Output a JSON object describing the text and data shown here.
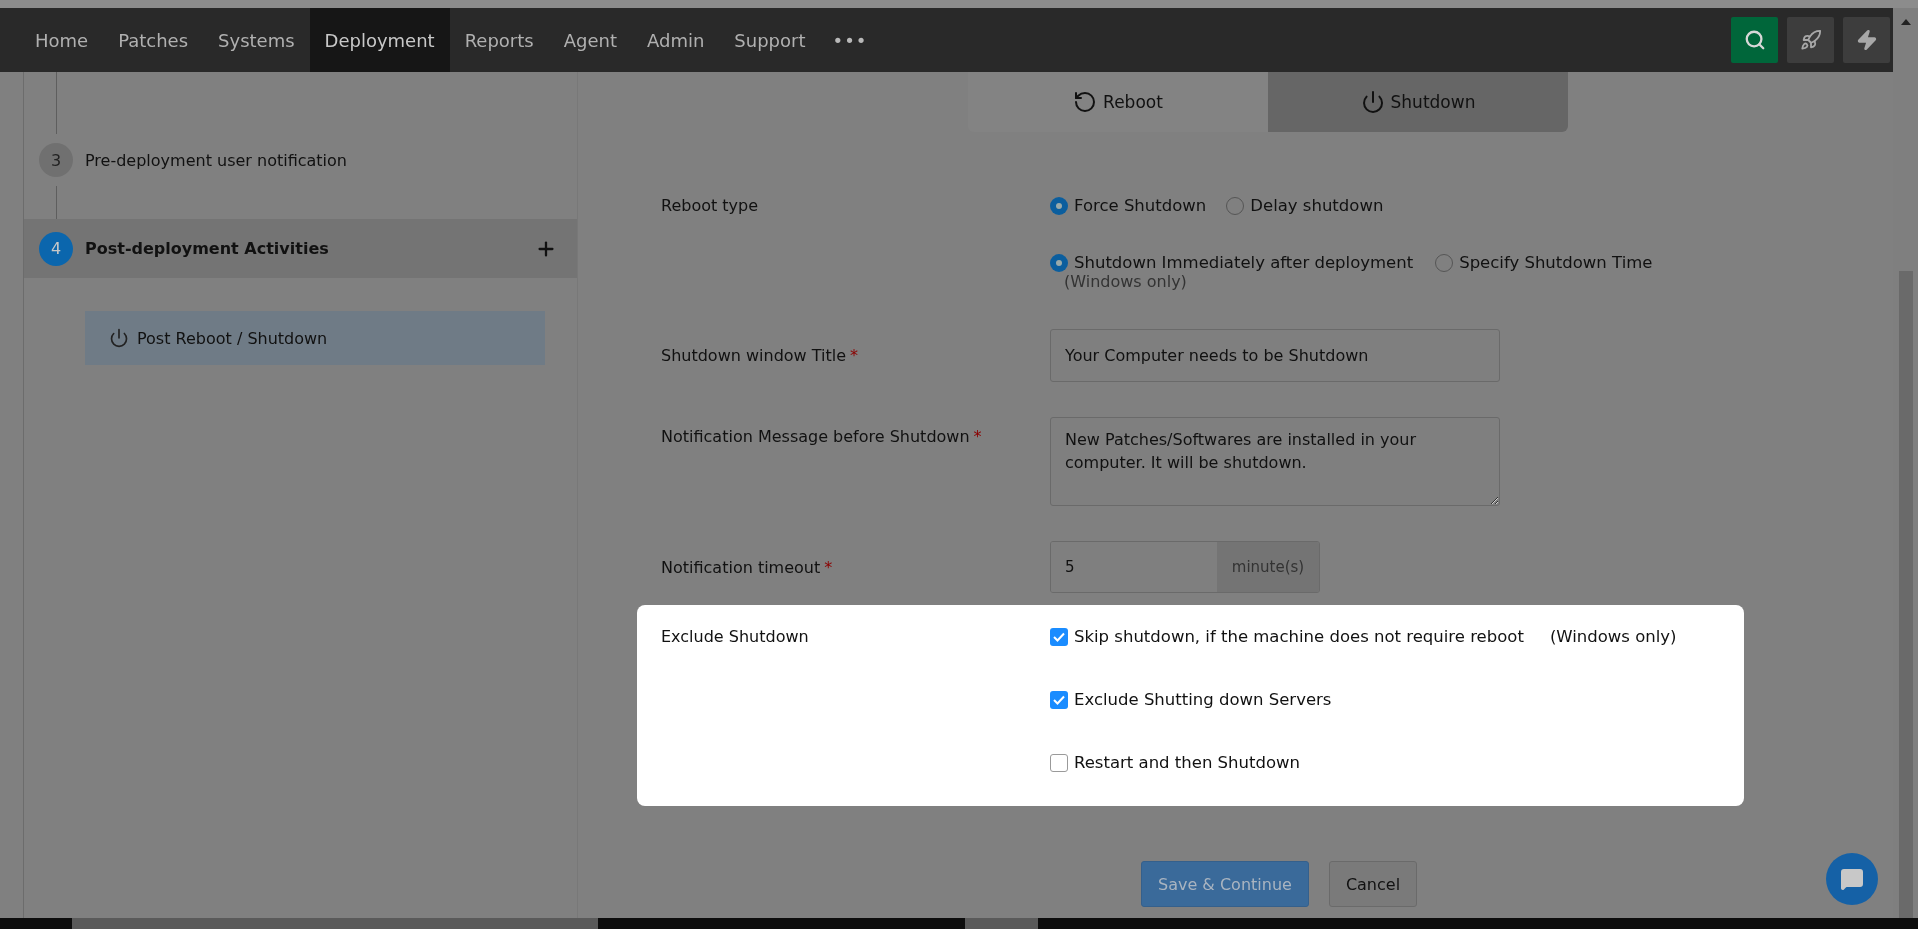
{
  "nav": {
    "items": [
      {
        "label": "Home",
        "selected": false
      },
      {
        "label": "Patches",
        "selected": false
      },
      {
        "label": "Systems",
        "selected": false
      },
      {
        "label": "Deployment",
        "selected": true
      },
      {
        "label": "Reports",
        "selected": false
      },
      {
        "label": "Agent",
        "selected": false
      },
      {
        "label": "Admin",
        "selected": false
      },
      {
        "label": "Support",
        "selected": false
      }
    ],
    "more": "•••"
  },
  "steps": [
    {
      "number": "3",
      "label": "Pre-deployment user notification",
      "selected": false,
      "expandable": false
    },
    {
      "number": "4",
      "label": "Post-deployment Activities",
      "selected": true,
      "expandable": true
    }
  ],
  "sub_item": {
    "label": "Post Reboot / Shutdown"
  },
  "mode_tabs": [
    {
      "label": "Reboot",
      "selected": false,
      "kind": "reboot"
    },
    {
      "label": "Shutdown",
      "selected": true,
      "kind": "shutdown"
    }
  ],
  "reboot_type": {
    "label": "Reboot type",
    "options": [
      {
        "label": "Force Shutdown",
        "selected": true
      },
      {
        "label": "Delay shutdown",
        "selected": false
      }
    ],
    "timing_options": [
      {
        "label": "Shutdown Immediately after deployment",
        "selected": true
      },
      {
        "label": "Specify Shutdown Time",
        "selected": false
      }
    ],
    "note": "(Windows only)"
  },
  "fields": [
    {
      "kind": "text",
      "label": "Shutdown window Title",
      "required_mark": "*",
      "value": "Your Computer needs to be Shutdown"
    },
    {
      "kind": "textarea",
      "label": "Notification Message before Shutdown",
      "required_mark": "*",
      "value": "New Patches/Softwares are installed in your computer. It will be shutdown."
    },
    {
      "kind": "addon",
      "label": "Notification timeout",
      "required_mark": "*",
      "value": "5",
      "addon": "minute(s)"
    }
  ],
  "exclude": {
    "label": "Exclude Shutdown",
    "options": [
      {
        "label": "Skip shutdown, if the machine does not require reboot",
        "checked": true,
        "note": "(Windows only)"
      },
      {
        "label": "Exclude Shutting down Servers",
        "checked": true
      },
      {
        "label": "Restart and then Shutdown",
        "checked": false
      }
    ]
  },
  "buttons": [
    {
      "label": "Save & Continue",
      "kind": "primary"
    },
    {
      "label": "Cancel",
      "kind": "secondary"
    }
  ]
}
